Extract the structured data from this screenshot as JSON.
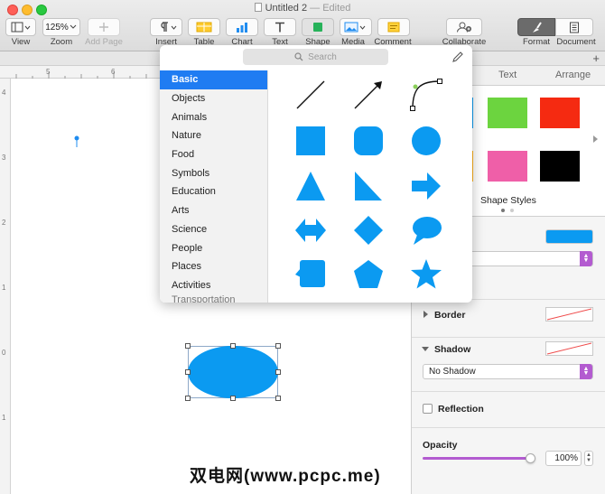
{
  "window": {
    "title": "Untitled 2",
    "edited": "— Edited"
  },
  "toolbar": {
    "view_label": "View",
    "zoom_value": "125%",
    "zoom_label": "Zoom",
    "add_page_label": "Add Page",
    "insert_label": "Insert",
    "table_label": "Table",
    "chart_label": "Chart",
    "text_label": "Text",
    "shape_label": "Shape",
    "media_label": "Media",
    "comment_label": "Comment",
    "collaborate_label": "Collaborate",
    "format_label": "Format",
    "document_label": "Document",
    "add_tab": "+"
  },
  "shape_picker": {
    "search_placeholder": "Search",
    "categories": [
      "Basic",
      "Objects",
      "Animals",
      "Nature",
      "Food",
      "Symbols",
      "Education",
      "Arts",
      "Science",
      "People",
      "Places",
      "Activities",
      "Transportation"
    ],
    "selected_category": "Basic",
    "shapes": [
      "line",
      "arrow-line",
      "curve",
      "square",
      "rounded-square",
      "circle",
      "triangle",
      "right-triangle",
      "arrow-right",
      "double-arrow",
      "diamond",
      "speech-bubble",
      "callout-square",
      "pentagon",
      "star"
    ],
    "shape_color": "#0b9af1"
  },
  "ruler": {
    "h_marks": [
      "5",
      "6"
    ],
    "v_marks": [
      "4",
      "3",
      "2",
      "1",
      "0",
      "1"
    ]
  },
  "sidebar": {
    "tabs": [
      "Text",
      "Arrange"
    ],
    "swatch_colors": [
      "#6cd43f",
      "#f52a11",
      "#ef5fa8",
      "#000000"
    ],
    "shape_styles_label": "Shape Styles",
    "fill_color": "#0b9af1",
    "border_label": "Border",
    "shadow_label": "Shadow",
    "shadow_value": "No Shadow",
    "reflection_label": "Reflection",
    "opacity_label": "Opacity",
    "opacity_value": "100%",
    "accent_color": "#b35bd0"
  },
  "watermark": "双电网(www.pcpc.me)"
}
